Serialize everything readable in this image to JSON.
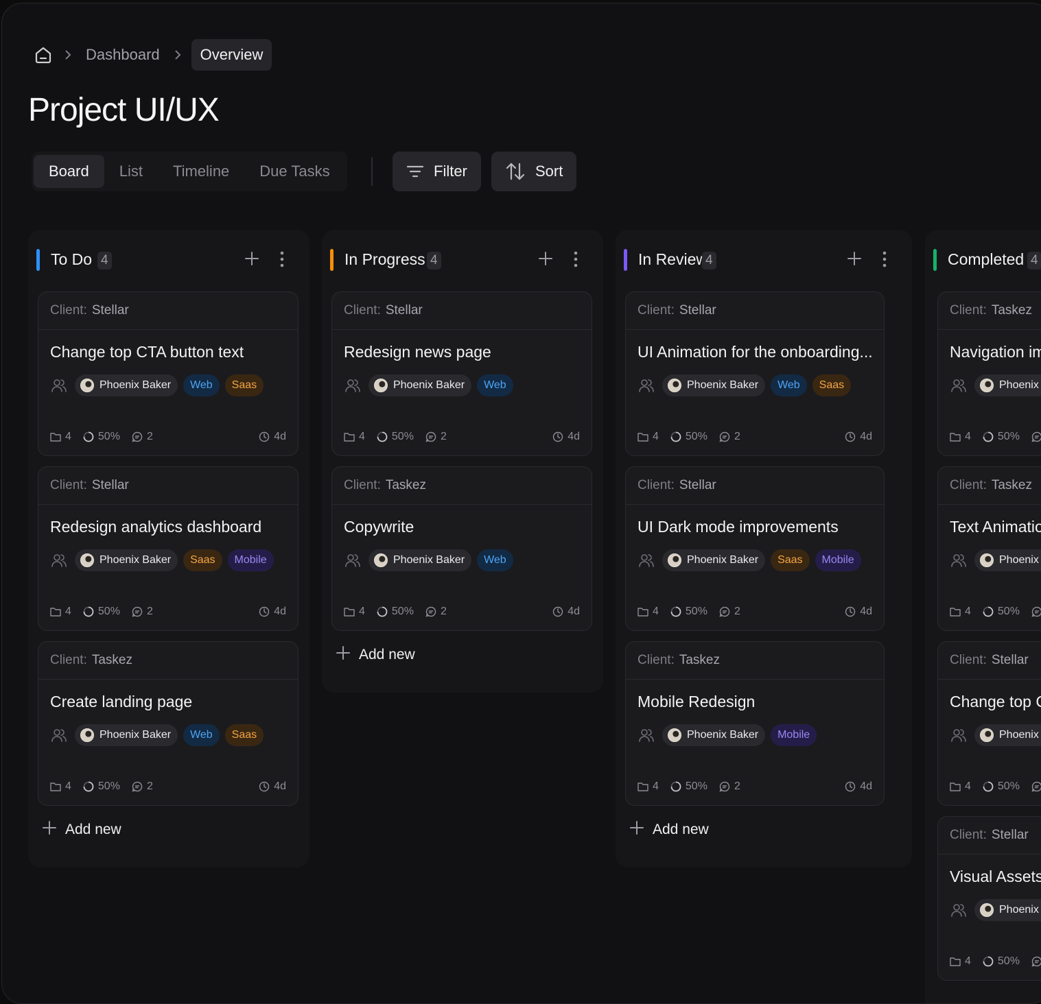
{
  "breadcrumb": {
    "items": [
      "Dashboard"
    ],
    "current": "Overview"
  },
  "page_title": "Project UI/UX",
  "view_tabs": [
    {
      "label": "Board",
      "active": true
    },
    {
      "label": "List",
      "active": false
    },
    {
      "label": "Timeline",
      "active": false
    },
    {
      "label": "Due Tasks",
      "active": false
    }
  ],
  "toolbar": {
    "filter_label": "Filter",
    "sort_label": "Sort"
  },
  "client_label": "Client:",
  "add_new_label": "Add new",
  "colors": {
    "todo": "#2e90fa",
    "in_progress": "#f79009",
    "in_review": "#7a5af8",
    "completed": "#17b26a",
    "tag_web": "#4ea4f5",
    "tag_saas": "#f3a543",
    "tag_mobile": "#9b87f5"
  },
  "columns": [
    {
      "id": "todo",
      "title": "To Do",
      "count": "4",
      "cards": [
        {
          "client": "Stellar",
          "title": "Change top CTA button text",
          "assignee": "Phoenix Baker",
          "tags": [
            "Web",
            "Saas"
          ],
          "files": "4",
          "progress": "50%",
          "comments": "2",
          "due": "4d"
        },
        {
          "client": "Stellar",
          "title": "Redesign analytics dashboard",
          "assignee": "Phoenix Baker",
          "tags": [
            "Saas",
            "Mobile"
          ],
          "files": "4",
          "progress": "50%",
          "comments": "2",
          "due": "4d"
        },
        {
          "client": "Taskez",
          "title": "Create landing page",
          "assignee": "Phoenix Baker",
          "tags": [
            "Web",
            "Saas"
          ],
          "files": "4",
          "progress": "50%",
          "comments": "2",
          "due": "4d"
        }
      ]
    },
    {
      "id": "in_progress",
      "title": "In Progress",
      "count": "4",
      "cards": [
        {
          "client": "Stellar",
          "title": "Redesign news page",
          "assignee": "Phoenix Baker",
          "tags": [
            "Web"
          ],
          "files": "4",
          "progress": "50%",
          "comments": "2",
          "due": "4d"
        },
        {
          "client": "Taskez",
          "title": "Copywrite",
          "assignee": "Phoenix Baker",
          "tags": [
            "Web"
          ],
          "files": "4",
          "progress": "50%",
          "comments": "2",
          "due": "4d"
        }
      ]
    },
    {
      "id": "in_review",
      "title": "In Review",
      "count": "4",
      "cards": [
        {
          "client": "Stellar",
          "title": "UI Animation for the onboarding...",
          "assignee": "Phoenix Baker",
          "tags": [
            "Web",
            "Saas"
          ],
          "files": "4",
          "progress": "50%",
          "comments": "2",
          "due": "4d"
        },
        {
          "client": "Stellar",
          "title": "UI Dark mode improvements",
          "assignee": "Phoenix Baker",
          "tags": [
            "Saas",
            "Mobile"
          ],
          "files": "4",
          "progress": "50%",
          "comments": "2",
          "due": "4d"
        },
        {
          "client": "Taskez",
          "title": "Mobile Redesign",
          "assignee": "Phoenix Baker",
          "tags": [
            "Mobile"
          ],
          "files": "4",
          "progress": "50%",
          "comments": "2",
          "due": "4d"
        }
      ]
    },
    {
      "id": "completed",
      "title": "Completed",
      "count": "4",
      "cards": [
        {
          "client": "Taskez",
          "title": "Navigation imp",
          "assignee": "Phoenix B",
          "tags": [],
          "files": "4",
          "progress": "50%",
          "comments": "",
          "due": ""
        },
        {
          "client": "Taskez",
          "title": "Text Animatio",
          "assignee": "Phoenix B",
          "tags": [],
          "files": "4",
          "progress": "50%",
          "comments": "",
          "due": ""
        },
        {
          "client": "Stellar",
          "title": "Change top C",
          "assignee": "Phoenix B",
          "tags": [],
          "files": "4",
          "progress": "50%",
          "comments": "",
          "due": ""
        },
        {
          "client": "Stellar",
          "title": "Visual Assets C",
          "assignee": "Phoenix B",
          "tags": [],
          "files": "4",
          "progress": "50%",
          "comments": "",
          "due": ""
        }
      ]
    }
  ]
}
